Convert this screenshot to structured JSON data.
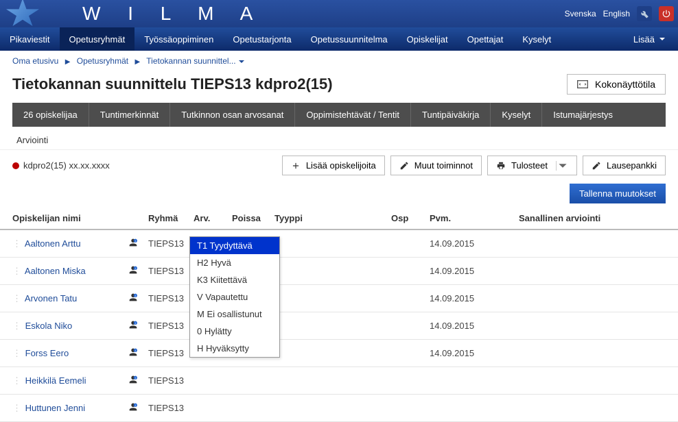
{
  "app": {
    "name": "W I L M A"
  },
  "langs": {
    "svenska": "Svenska",
    "english": "English"
  },
  "nav": {
    "items": [
      "Pikaviestit",
      "Opetusryhmät",
      "Työssäoppiminen",
      "Opetustarjonta",
      "Opetussuunnitelma",
      "Opiskelijat",
      "Opettajat",
      "Kyselyt"
    ],
    "more": "Lisää"
  },
  "breadcrumb": {
    "a": "Oma etusivu",
    "b": "Opetusryhmät",
    "c": "Tietokannan suunnittel..."
  },
  "page": {
    "title": "Tietokannan suunnittelu TIEPS13 kdpro2(15)",
    "fullscreen": "Kokonäyttötila"
  },
  "subtabs": [
    "26 opiskelijaa",
    "Tuntimerkinnät",
    "Tutkinnon osan arvosanat",
    "Oppimistehtävät / Tentit",
    "Tuntipäiväkirja",
    "Kyselyt",
    "Istumajärjestys"
  ],
  "sub_bc": "Arviointi",
  "status": "kdpro2(15) xx.xx.xxxx",
  "actions": {
    "add": "Lisää opiskelijoita",
    "other": "Muut toiminnot",
    "print": "Tulosteet",
    "bank": "Lausepankki"
  },
  "save": "Tallenna muutokset",
  "cols": {
    "name": "Opiskelijan nimi",
    "group": "Ryhmä",
    "arv": "Arv.",
    "poissa": "Poissa",
    "tyyppi": "Tyyppi",
    "osp": "Osp",
    "pvm": "Pvm.",
    "verbal": "Sanallinen arviointi"
  },
  "rows": [
    {
      "name": "Aaltonen Arttu",
      "group": "TIEPS13",
      "pvm": "14.09.2015"
    },
    {
      "name": "Aaltonen Miska",
      "group": "TIEPS13",
      "pvm": "14.09.2015"
    },
    {
      "name": "Arvonen Tatu",
      "group": "TIEPS13",
      "pvm": "14.09.2015"
    },
    {
      "name": "Eskola Niko",
      "group": "TIEPS13",
      "pvm": "14.09.2015"
    },
    {
      "name": "Forss Eero",
      "group": "TIEPS13",
      "pvm": "14.09.2015"
    },
    {
      "name": "Heikkilä Eemeli",
      "group": "TIEPS13",
      "pvm": ""
    },
    {
      "name": "Huttunen Jenni",
      "group": "TIEPS13",
      "pvm": ""
    }
  ],
  "dropdown": [
    "T1 Tyydyttävä",
    "H2 Hyvä",
    "K3 Kiitettävä",
    "V Vapautettu",
    "M Ei osallistunut",
    "0 Hylätty",
    "H Hyväksytty"
  ]
}
